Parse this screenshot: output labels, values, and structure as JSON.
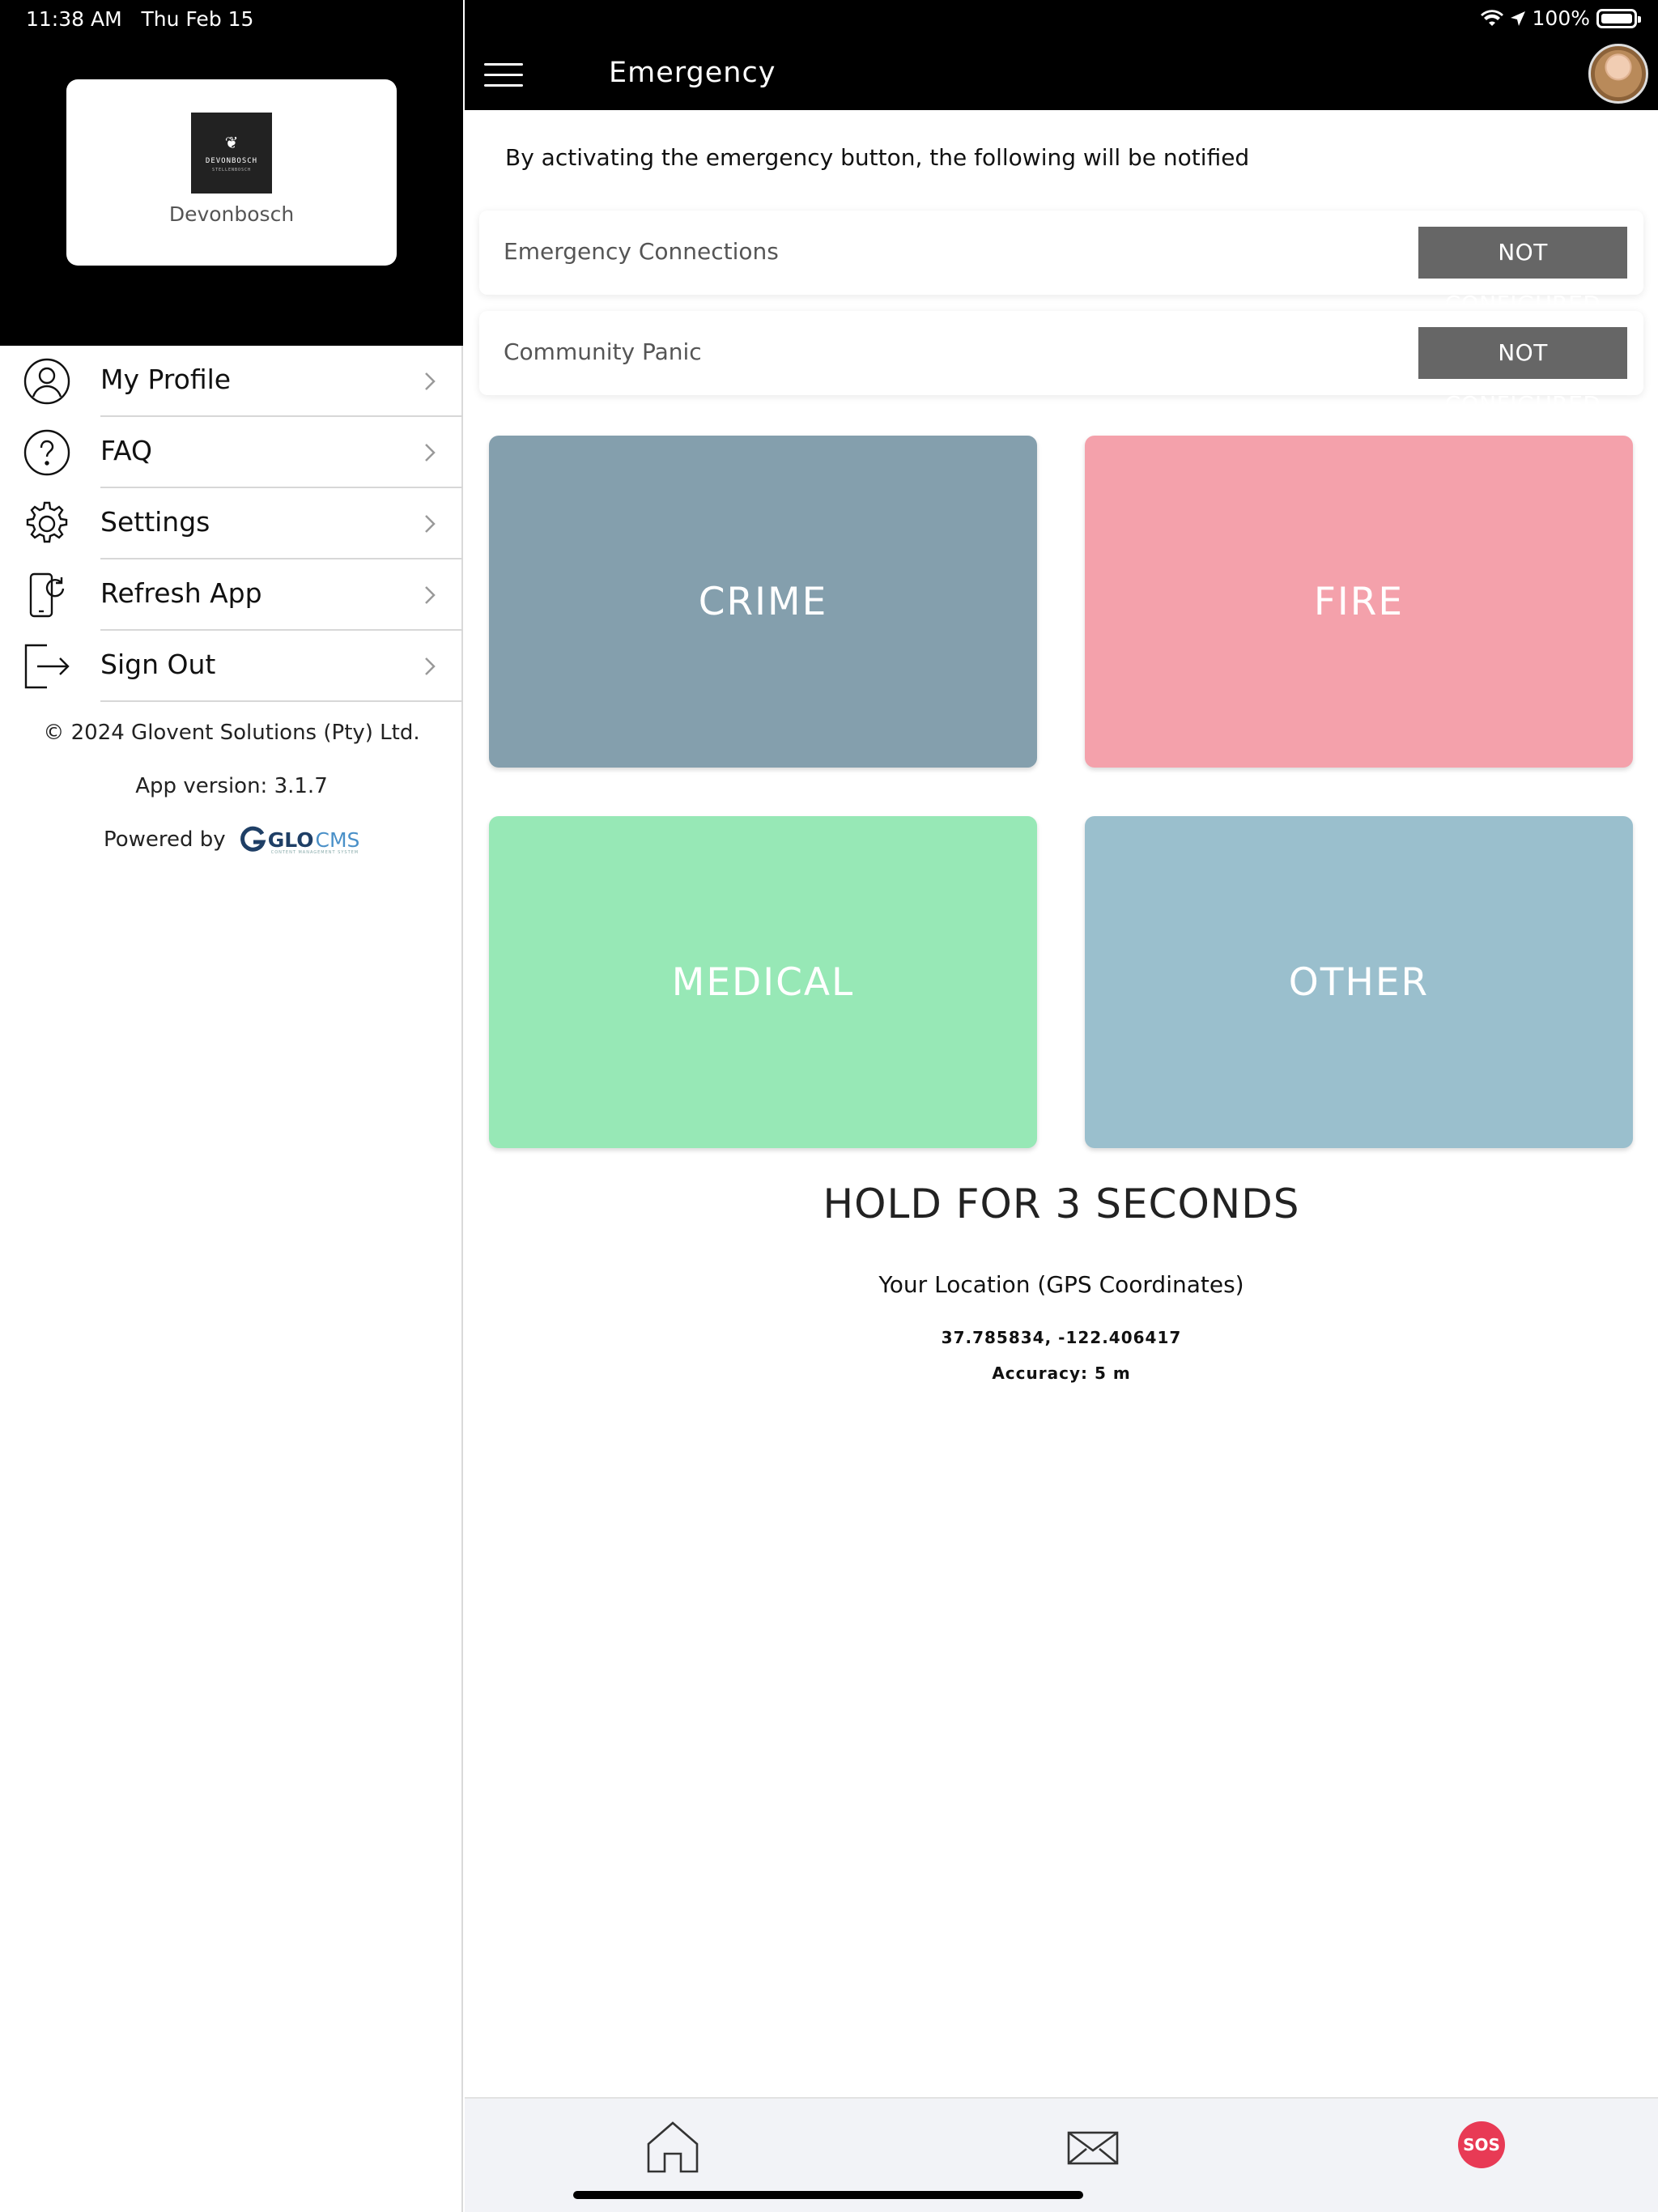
{
  "status_bar": {
    "time": "11:38 AM",
    "date": "Thu Feb 15",
    "battery": "100%"
  },
  "sidebar": {
    "brand_name": "Devonbosch",
    "logo_wordmark": "DEVONBOSCH",
    "logo_subtext": "STELLENBOSCH",
    "items": [
      {
        "label": "My Profile",
        "icon": "user-circle-icon"
      },
      {
        "label": "FAQ",
        "icon": "question-circle-icon"
      },
      {
        "label": "Settings",
        "icon": "gear-icon"
      },
      {
        "label": "Refresh App",
        "icon": "phone-refresh-icon"
      },
      {
        "label": "Sign Out",
        "icon": "sign-out-icon"
      }
    ],
    "copyright": "© 2024 Glovent Solutions (Pty) Ltd.",
    "version": "App version: 3.1.7",
    "powered_by": "Powered by",
    "powered_logo_main": "GLO",
    "powered_logo_accent": "CMS",
    "powered_logo_tag": "CONTENT MANAGEMENT SYSTEM"
  },
  "header": {
    "title": "Emergency"
  },
  "intro": "By activating the emergency button, the following will be notified",
  "notifications": [
    {
      "label": "Emergency Connections",
      "status": "NOT CONFIGURED"
    },
    {
      "label": "Community Panic",
      "status": "NOT CONFIGURED"
    }
  ],
  "emergency_buttons": [
    {
      "label": "CRIME",
      "color": "#849fad"
    },
    {
      "label": "FIRE",
      "color": "#f4a1ab"
    },
    {
      "label": "MEDICAL",
      "color": "#97e8b6"
    },
    {
      "label": "OTHER",
      "color": "#9abfcd"
    }
  ],
  "hold_text": "HOLD FOR 3 SECONDS",
  "location": {
    "title": "Your Location (GPS Coordinates)",
    "coords": "37.785834, -122.406417",
    "accuracy": "Accuracy: 5 m"
  },
  "tab_bar": {
    "sos_label": "SOS"
  },
  "colors": {
    "header_bg": "#000000",
    "badge_bg": "#666666",
    "sos": "#e83a55"
  }
}
